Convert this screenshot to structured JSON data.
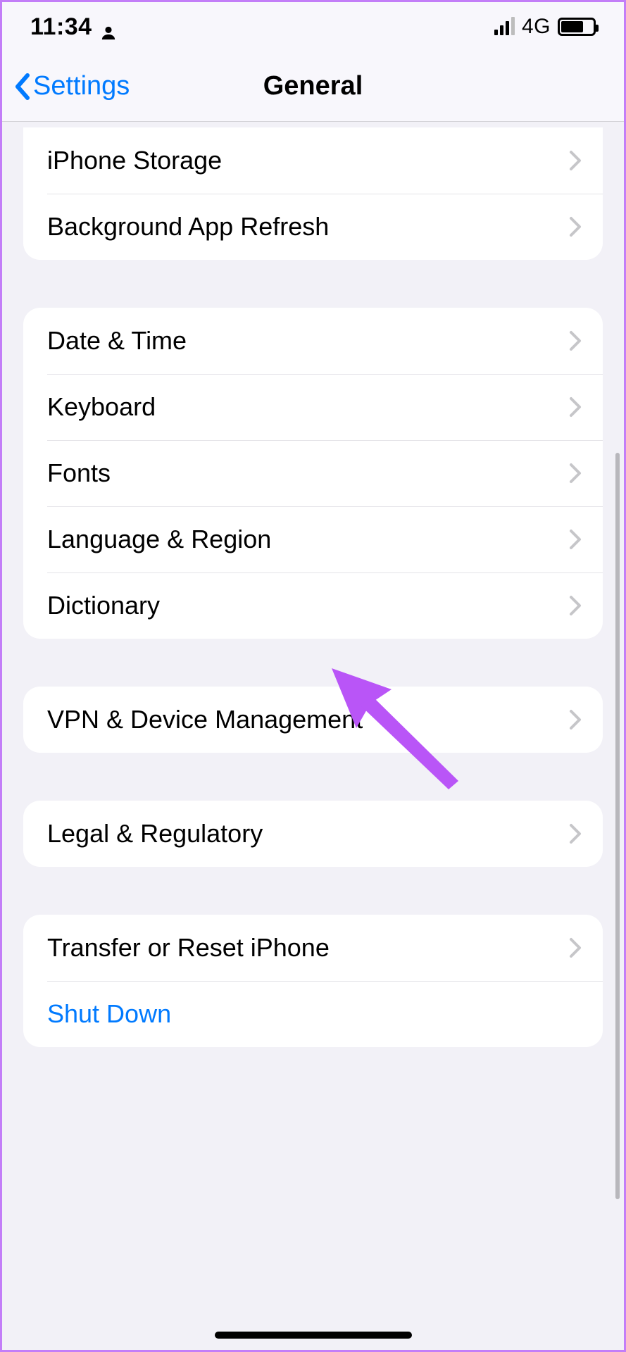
{
  "status": {
    "time": "11:34",
    "network": "4G"
  },
  "nav": {
    "back_label": "Settings",
    "title": "General"
  },
  "groups": [
    {
      "rows": [
        {
          "label": "iPhone Storage",
          "name": "row-iphone-storage"
        },
        {
          "label": "Background App Refresh",
          "name": "row-background-app-refresh"
        }
      ]
    },
    {
      "rows": [
        {
          "label": "Date & Time",
          "name": "row-date-time"
        },
        {
          "label": "Keyboard",
          "name": "row-keyboard"
        },
        {
          "label": "Fonts",
          "name": "row-fonts"
        },
        {
          "label": "Language & Region",
          "name": "row-language-region"
        },
        {
          "label": "Dictionary",
          "name": "row-dictionary"
        }
      ]
    },
    {
      "rows": [
        {
          "label": "VPN & Device Management",
          "name": "row-vpn-device-management"
        }
      ]
    },
    {
      "rows": [
        {
          "label": "Legal & Regulatory",
          "name": "row-legal-regulatory"
        }
      ]
    },
    {
      "rows": [
        {
          "label": "Transfer or Reset iPhone",
          "name": "row-transfer-reset"
        },
        {
          "label": "Shut Down",
          "name": "row-shut-down",
          "link": true,
          "no_chevron": true
        }
      ]
    }
  ],
  "annotation": {
    "arrow_color": "#b955f7"
  }
}
